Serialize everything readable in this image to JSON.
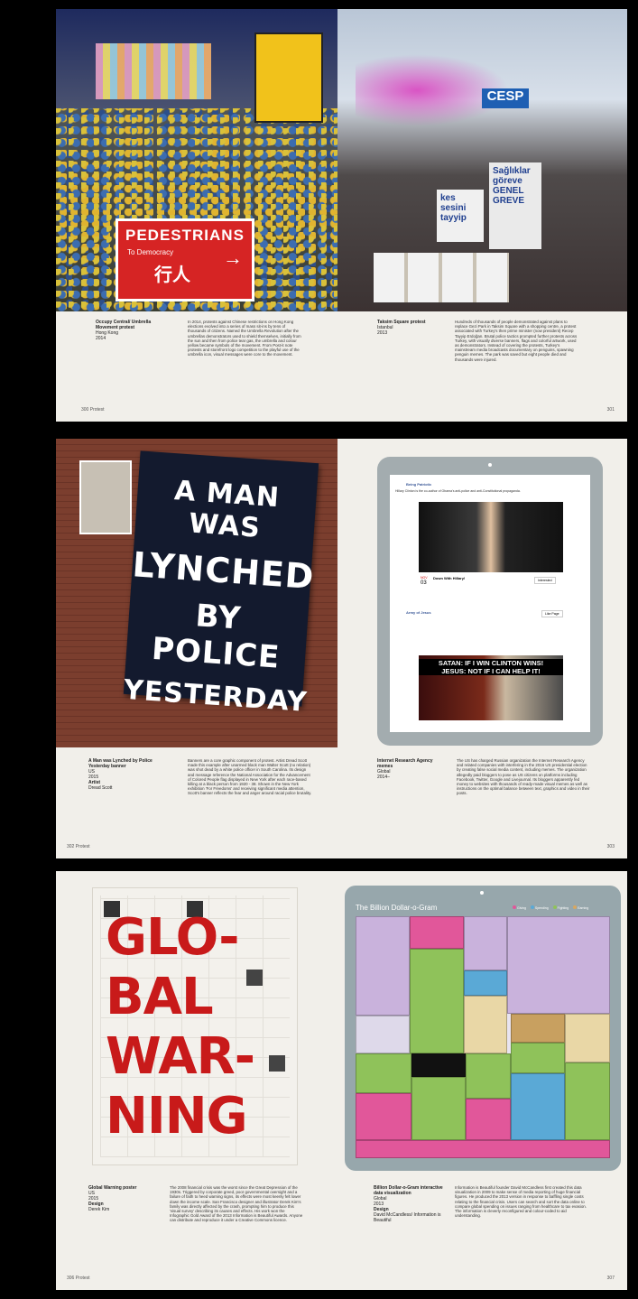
{
  "spread1": {
    "left": {
      "sign_title": "PEDESTRIANS",
      "sign_sub": "To Democracy",
      "sign_chinese": "行人",
      "caption_title": "Occupy Central/ Umbrella Movement protest",
      "caption_place": "Hong Kong",
      "caption_year": "2014",
      "body": "In 2014, protests against Chinese restrictions on Hong Kong elections evolved into a series of mass sit-ins by tens of thousands of citizens. Named the Umbrella Revolution after the umbrellas demonstrators used to shield themselves, initially from the sun and then from police tear gas, the umbrella and colour yellow became symbols of the movement. From Post-it note protests and storefront logo competition to the playful use of the umbrella icon, visual messages were core to the movement.",
      "folio": "300  Protest"
    },
    "right": {
      "banner1": "kes sesini tayyip",
      "banner2": "Sağlıklar göreve GENEL GREVE",
      "banner3": "CESP",
      "caption_title": "Taksim Square protest",
      "caption_place": "Istanbul",
      "caption_year": "2013",
      "body": "Hundreds of thousands of people demonstrated against plans to replace Gezi Park in Taksim Square with a shopping centre, a protest associated with Turkey's then prime minister (now president) Recep Tayyip Erdoğan. Brutal police tactics prompted further protests across Turkey, with visually diverse banners, flags and colorful artwork, used as demonstrators. Instead of covering the protests, Turkey's mainstream media broadcasts documentary on penguins, spawning penguin memes. The park was saved but eight people died and thousands were injured.",
      "folio": "301"
    }
  },
  "spread2": {
    "left": {
      "flag_lines": [
        "A MAN WAS",
        "LYNCHED",
        "BY POLICE",
        "YESTERDAY"
      ],
      "caption_title": "A Man was Lynched by Police Yesterday banner",
      "caption_place": "US",
      "caption_year": "2015",
      "artist_label": "Artist",
      "artist": "Dread Scott",
      "body": "Banners are a core graphic component of protest. Artist Dread Scott made this example after unarmed black man Walter Scott (no relation) was shot dead by a white police officer in South Carolina. Its design and message reference the National Association for the Advancement of Colored People flag displayed in New York after each race-based killing at a black person from 1920 - 38. Shown in the New York exhibition 'For Freedoms' and receiving significant media attention, Scott's banner reflects the fear and anger around racial police brutality.",
      "folio": "302  Protest"
    },
    "right": {
      "post1_name": "Being Patriotic",
      "post1_text": "Hillary Clinton is the co-author of Obama's anti-police and anti-Constitutional propaganda.",
      "event_month": "NOV",
      "event_day": "03",
      "event_title": "Down With Hillary!",
      "event_button": "Interested",
      "post2_name": "Army of Jesus",
      "post2_button": "Like Page",
      "meme_line1": "SATAN: IF I WIN CLINTON WINS!",
      "meme_line2": "JESUS: NOT IF I CAN HELP IT!",
      "caption_title": "Internet Research Agency memes",
      "caption_place": "Global",
      "caption_year": "2014–",
      "body": "The US has charged Russian organization the Internet Research Agency and related companies with interfering in the 2016 US presidential election by creating false social media content, including memes. The organization allegedly paid bloggers to pose as US citizens on platforms including Facebook, Twitter, Google and Livejournal. Its bloggers apparently fed money to websites with thousands of ready-made visual memes as well as instructions on the optimal balance between text, graphics and video in their posts.",
      "folio": "303"
    }
  },
  "spread3": {
    "left": {
      "poster_lines": [
        "GLO-",
        "BAL",
        "WAR-",
        "NING"
      ],
      "caption_title": "Global Warning poster",
      "caption_place": "US",
      "caption_year": "2015",
      "design_label": "Design",
      "designer": "Derek Kim",
      "body": "The 2008 financial crisis was the worst since the Great Depression of the 1930s. Triggered by corporate greed, poor governmental oversight and a failure of faith to heed warning signs, its effects were most keenly felt lower down the income scale. San Francisco designer and illustrator Derek Kim's family was directly affected by the crash, prompting him to produce this 'visual survey' describing its causes and effects. His work won the Infographic Gold Award of the 2013 Information is Beautiful Awards. Anyone can distribute and reproduce it under a Creative Commons licence.",
      "folio": "306  Protest"
    },
    "right": {
      "viz_title": "The Billion Dollar-o-Gram",
      "legend": [
        {
          "label": "Giving",
          "color": "#e1579a"
        },
        {
          "label": "Spending",
          "color": "#5aa9d6"
        },
        {
          "label": "Fighting",
          "color": "#8fc25a"
        },
        {
          "label": "Earning",
          "color": "#d8a760"
        }
      ],
      "caption_title": "Billion Dollar-o-Gram interactive data visualization",
      "caption_place": "Global",
      "caption_year": "2013",
      "design_label": "Design",
      "designer": "David McCandless/ Information is Beautiful",
      "body": "Information is Beautiful founder David McCandless first created this data visualization in 2009 to make sense of media reporting of huge financial figures. He produced the 2013 version in response to baffling single costs relating to the financial crisis. Users can search and sort the data online to compare global spending on issues ranging from healthcare to tax evasion. The information is cleverly reconfigured and colour-coded to aid understanding.",
      "folio": "307"
    }
  }
}
